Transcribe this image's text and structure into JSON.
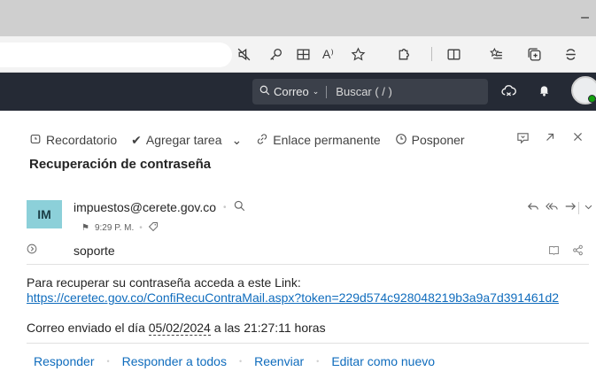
{
  "browser": {
    "minimize_glyph": "–",
    "toolbar_icons": [
      "mute-icon",
      "key-icon",
      "grid-icon",
      "read-aloud-icon",
      "favorite-star-icon",
      "extensions-icon",
      "split-screen-icon",
      "favorites-list-icon",
      "collections-icon",
      "copilot-icon"
    ],
    "read_aloud_label": "A⁾"
  },
  "app": {
    "search_scope": "Correo",
    "search_placeholder": "Buscar ( / )"
  },
  "toolbar": {
    "reminder": "Recordatorio",
    "add_task": "Agregar tarea",
    "permalink": "Enlace permanente",
    "snooze": "Posponer"
  },
  "message": {
    "subject": "Recuperación de contraseña",
    "avatar_initials": "IM",
    "sender": "impuestos@cerete.gov.co",
    "time": "9:29 P. M.",
    "to": "soporte",
    "body_line1": "Para recuperar su contraseña acceda a este Link:",
    "link": "https://ceretec.gov.co/ConfiRecuContraMail.aspx?token=229d574c928048219b3a9a7d391461d2",
    "sent_prefix": "Correo enviado el día ",
    "sent_date": "05/02/2024",
    "sent_suffix": " a las 21:27:11 horas"
  },
  "reply_actions": {
    "reply": "Responder",
    "reply_all": "Responder a todos",
    "forward": "Reenviar",
    "edit_as_new": "Editar como nuevo"
  },
  "colors": {
    "app_header": "#252a35",
    "link": "#0f6cbd",
    "avatar_bg": "#8cd0d9",
    "presence": "#13a10e"
  }
}
